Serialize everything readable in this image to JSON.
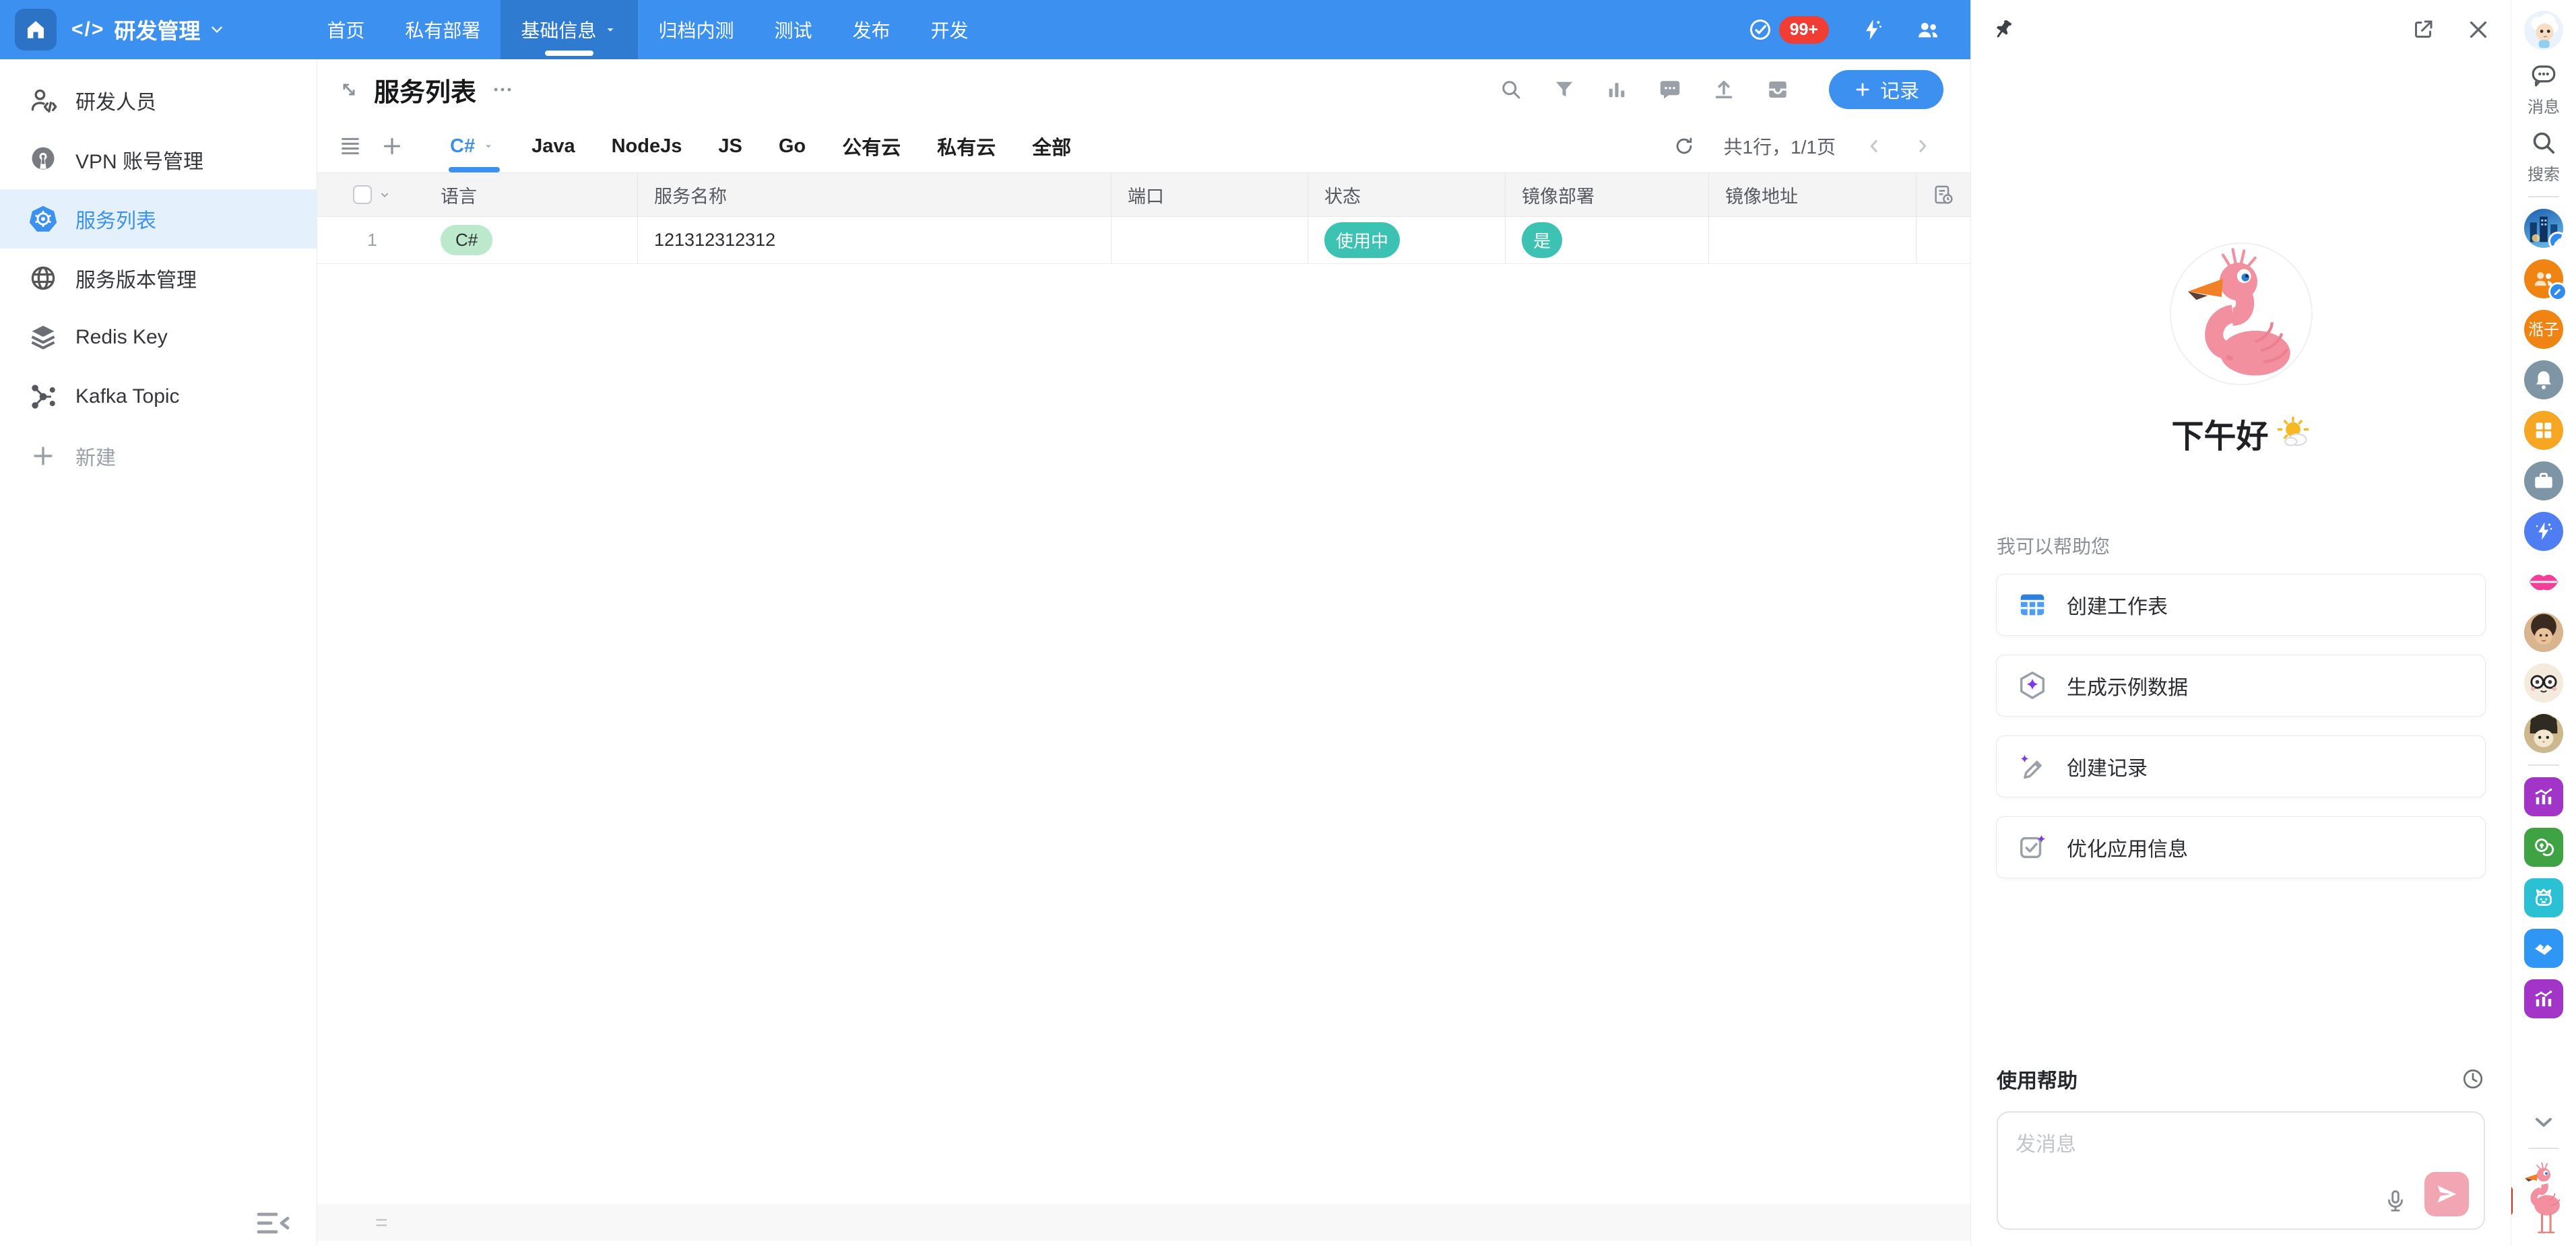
{
  "topbar": {
    "app_name": "研发管理",
    "app_code": "</>",
    "nav": [
      {
        "label": "首页"
      },
      {
        "label": "私有部署"
      },
      {
        "label": "基础信息",
        "active": true
      },
      {
        "label": "归档内测"
      },
      {
        "label": "测试"
      },
      {
        "label": "发布"
      },
      {
        "label": "开发"
      }
    ],
    "notification_badge": "99+"
  },
  "sidebar": {
    "items": [
      {
        "label": "研发人员",
        "icon": "dev-person-icon"
      },
      {
        "label": "VPN 账号管理",
        "icon": "vpn-icon"
      },
      {
        "label": "服务列表",
        "icon": "kubernetes-icon",
        "active": true
      },
      {
        "label": "服务版本管理",
        "icon": "globe-icon"
      },
      {
        "label": "Redis Key",
        "icon": "layers-icon"
      },
      {
        "label": "Kafka Topic",
        "icon": "graph-icon"
      }
    ],
    "new_button_label": "新建"
  },
  "main": {
    "title": "服务列表",
    "add_record_label": "记录",
    "views": [
      {
        "label": "C#",
        "active": true
      },
      {
        "label": "Java"
      },
      {
        "label": "NodeJs"
      },
      {
        "label": "JS"
      },
      {
        "label": "Go"
      },
      {
        "label": "公有云"
      },
      {
        "label": "私有云"
      },
      {
        "label": "全部"
      }
    ],
    "pagination": "共1行，1/1页",
    "table": {
      "columns": [
        "语言",
        "服务名称",
        "端口",
        "状态",
        "镜像部署",
        "镜像地址"
      ],
      "rows": [
        {
          "num": "1",
          "language": "C#",
          "service_name": "121312312312",
          "port": "",
          "status": "使用中",
          "image_deploy": "是",
          "image_address": ""
        }
      ]
    },
    "footer_handle": "="
  },
  "assistant": {
    "greeting": "下午好",
    "intro": "我可以帮助您",
    "actions": [
      {
        "label": "创建工作表",
        "icon": "table-icon"
      },
      {
        "label": "生成示例数据",
        "icon": "hexagon-sparkle-icon"
      },
      {
        "label": "创建记录",
        "icon": "pencil-sparkle-icon"
      },
      {
        "label": "优化应用信息",
        "icon": "check-sparkle-icon"
      }
    ],
    "help_label": "使用帮助",
    "input_placeholder": "发消息"
  },
  "rail": {
    "message_label": "消息",
    "search_label": "搜索",
    "name_avatar_text": "湉子"
  },
  "colors": {
    "accent_blue": "#3b90f0",
    "teal_pill": "#3bc2b2",
    "green_pill": "#bce9cb",
    "red_badge": "#f03e35",
    "purple_sparkle": "#7c3aed",
    "send_pink": "#f2a6b3",
    "orange_avatar": "#f08413"
  }
}
